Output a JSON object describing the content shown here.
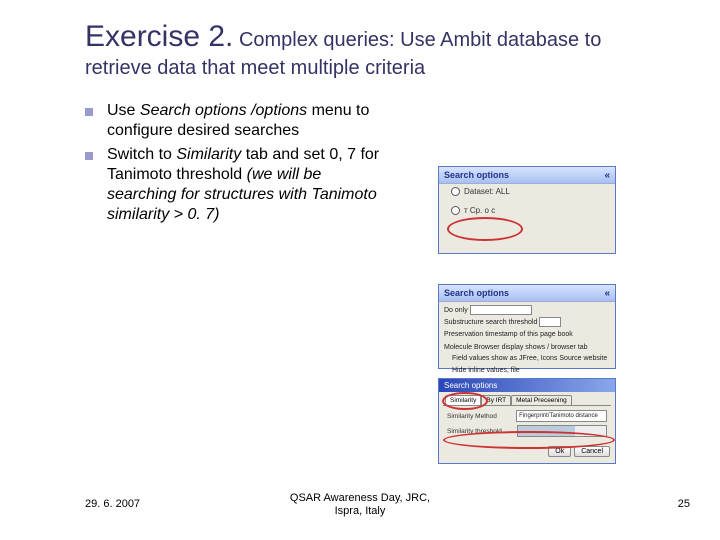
{
  "title": {
    "ex": "Exercise 2.",
    "rest": " Complex queries: Use Ambit database to retrieve data that meet multiple criteria"
  },
  "bullets": [
    {
      "parts": [
        {
          "t": "Use "
        },
        {
          "t": "Search options /options",
          "i": true
        },
        {
          "t": " menu to configure desired searches"
        }
      ]
    },
    {
      "parts": [
        {
          "t": "Switch to "
        },
        {
          "t": "Similarity",
          "i": true
        },
        {
          "t": " tab and set 0, 7 for Tanimoto threshold "
        },
        {
          "t": "(we will be searching for structures with Tanimoto similarity > 0. 7)",
          "i": true
        }
      ]
    }
  ],
  "panel1": {
    "title": "Search options",
    "opt1": "Dataset: ALL",
    "opt2": "т Ср. о с"
  },
  "panel2": {
    "title": "Search options",
    "rows": {
      "r1a": "Do only",
      "r2a": "Substructure search threshold",
      "r3a": "Preservation timestamp of this page book",
      "r4a": "Molecule Browser display shows / browser tab",
      "r4b": "Field values show as JFree, Icons Source website",
      "r4c": "Hide inline values, file"
    }
  },
  "panel3": {
    "title": "Search options",
    "tabs": {
      "t1": "Similarity",
      "t2": "By IRT",
      "t3": "Metal Preceening"
    },
    "r1l": "Similarity Method",
    "r1v": "Fingerprint/Tanimoto distance",
    "r2l": "Similarity threshold",
    "ok": "Ok",
    "cancel": "Cancel"
  },
  "footer": {
    "date": "29. 6. 2007",
    "center1": "QSAR Awareness Day, JRC,",
    "center2": "Ispra, Italy",
    "num": "25"
  }
}
